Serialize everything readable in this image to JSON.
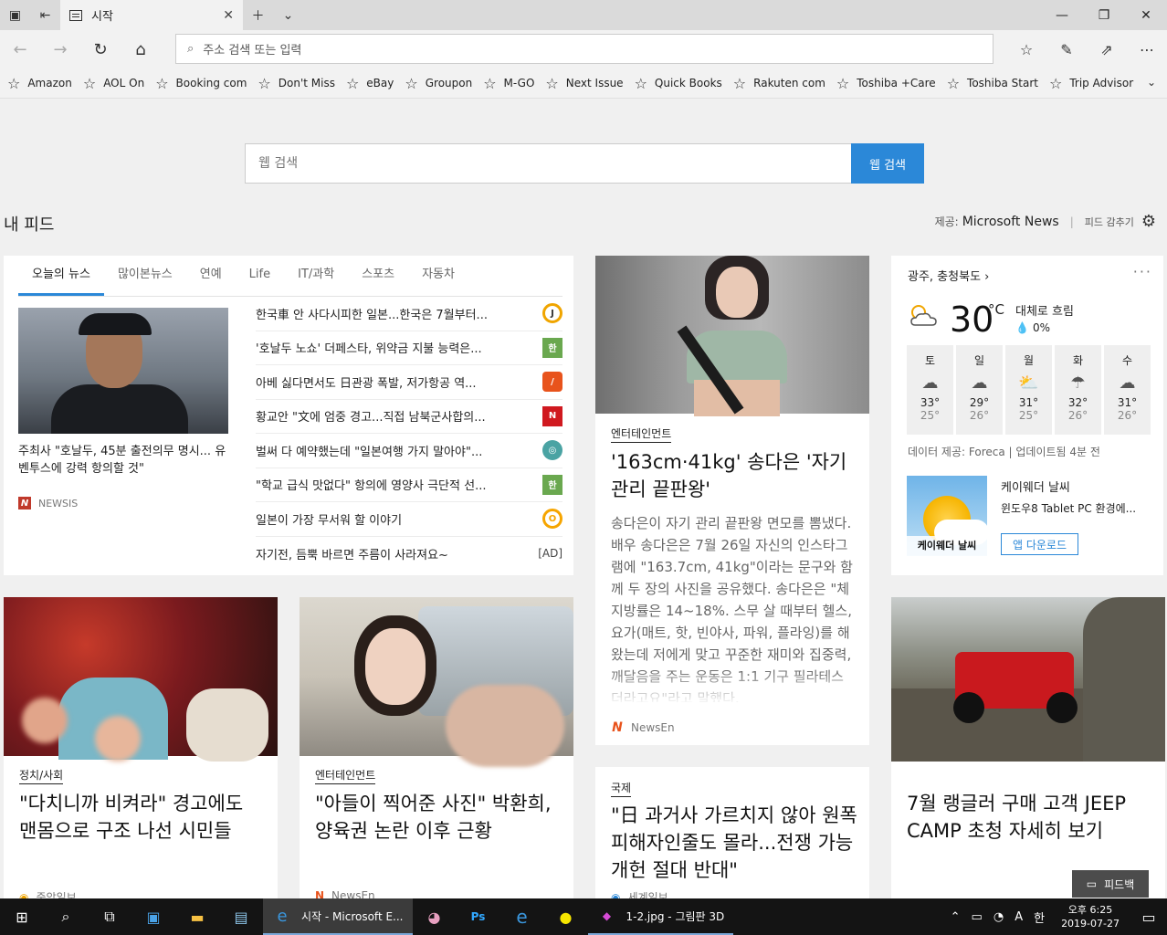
{
  "browser": {
    "tab_title": "시작",
    "address_placeholder": "주소 검색 또는 입력"
  },
  "favorites": [
    "Amazon",
    "AOL On",
    "Booking com",
    "Don't Miss",
    "eBay",
    "Groupon",
    "M-GO",
    "Next Issue",
    "Quick Books",
    "Rakuten com",
    "Toshiba +Care",
    "Toshiba Start",
    "Trip Advisor"
  ],
  "search": {
    "placeholder": "웹 검색",
    "button": "웹 검색"
  },
  "feed": {
    "title": "내 피드",
    "provider_label": "제공:",
    "provider": "Microsoft News",
    "hide": "피드 감추기"
  },
  "news": {
    "tabs": [
      "오늘의 뉴스",
      "많이본뉴스",
      "연예",
      "Life",
      "IT/과학",
      "스포츠",
      "자동차"
    ],
    "hero_caption": "주최사 \"호날두, 45분 출전의무 명시... 유벤투스에 강력 항의할 것\"",
    "hero_source": "NEWSIS",
    "headlines": [
      {
        "text": "한국車 안 사다시피한 일본...한국은 7월부터...",
        "icon": "circle-yellow"
      },
      {
        "text": "'호날두 노쇼' 더페스타, 위약금 지불 능력은...",
        "icon": "green-square"
      },
      {
        "text": "아베 싫다면서도 日관광 폭발, 저가항공 역...",
        "icon": "orange-square"
      },
      {
        "text": "황교안 \"文에 엄중 경고...직접 남북군사합의...",
        "icon": "red-n"
      },
      {
        "text": "벌써 다 예약했는데 \"일본여행 가지 말아야\"...",
        "icon": "globe"
      },
      {
        "text": "\"학교 급식 맛없다\" 항의에 영양사 극단적 선...",
        "icon": "green-square"
      },
      {
        "text": "일본이 가장 무서워 할 이야기",
        "icon": "circle-orange"
      },
      {
        "text": "자기전, 듬뿍 바르면 주름이 사라져요~",
        "icon": "ad",
        "ad": "[AD]"
      }
    ]
  },
  "articles": {
    "woman": {
      "category": "엔터테인먼트",
      "headline": "'163cm·41kg' 송다은 '자기 관리 끝판왕'",
      "body": "송다은이 자기 관리 끝판왕 면모를 뽐냈다.배우 송다은은 7월 26일 자신의 인스타그램에 \"163.7cm, 41kg\"이라는 문구와 함께 두 장의 사진을 공유했다. 송다은은 \"체지방률은 14~18%. 스무 살 때부터 헬스, 요가(매트, 핫, 빈야사, 파워, 플라잉)를 해왔는데 저에게 맞고 꾸준한 재미와 집중력, 깨달음을 주는 운동은 1:1 기구 필라테스더라고요\"라고 말했다.",
      "source": "NewsEn"
    },
    "protest": {
      "category": "정치/사회",
      "headline": "\"다치니까 비켜라\" 경고에도 맨몸으로 구조 나선 시민들",
      "source": "중앙일보"
    },
    "car": {
      "category": "엔터테인먼트",
      "headline": "\"아들이 찍어준 사진\" 박환희, 양육권 논란 이후 근황",
      "source": "NewsEn"
    },
    "intl": {
      "category": "국제",
      "headline": "\"日 과거사 가르치지 않아 원폭 피해자인줄도 몰라...전쟁 가능 개헌 절대 반대\"",
      "source": "세계일보"
    },
    "jeep": {
      "headline": "7월 랭글러 구매 고객 JEEP CAMP 초청 자세히 보기"
    }
  },
  "weather": {
    "location": "광주, 충청북도",
    "temp": "30",
    "unit": "°C",
    "condition": "대체로 흐림",
    "rain": "0%",
    "days": [
      {
        "day": "토",
        "hi": "33°",
        "lo": "25°"
      },
      {
        "day": "일",
        "hi": "29°",
        "lo": "26°"
      },
      {
        "day": "월",
        "hi": "31°",
        "lo": "25°"
      },
      {
        "day": "화",
        "hi": "32°",
        "lo": "26°"
      },
      {
        "day": "수",
        "hi": "31°",
        "lo": "26°"
      }
    ],
    "data_provider": "데이터 제공: Foreca | 업데이트됨 4분 전",
    "ad_image_label": "케이웨더 날씨",
    "ad_title": "케이웨더 날씨",
    "ad_desc": "윈도우8 Tablet PC 환경에...",
    "ad_button": "앱 다운로드"
  },
  "feedback": "피드백",
  "taskbar": {
    "apps": [
      {
        "label": "시작 - Microsoft E..."
      },
      {
        "label": "1-2.jpg - 그림판 3D"
      }
    ],
    "ime": "A",
    "hangul": "한",
    "time": "오후 6:25",
    "date": "2019-07-27"
  }
}
